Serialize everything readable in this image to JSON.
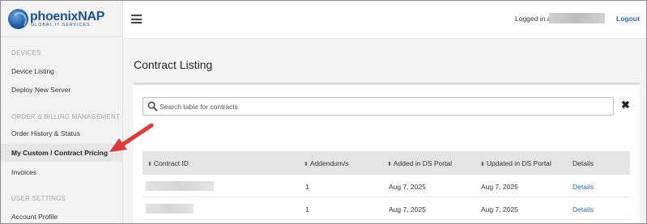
{
  "brand": {
    "name_part1": "phoenix",
    "name_part2": "NAP",
    "tagline": "GLOBAL IT SERVICES",
    "color": "#1d4f91"
  },
  "sidebar": {
    "sections": [
      {
        "heading": "DEVICES",
        "items": [
          "Device Listing",
          "Deploy New Server"
        ]
      },
      {
        "heading": "ORDER & BILLING MANAGEMENT",
        "items": [
          "Order History & Status",
          "My Custom / Contract Pricing",
          "Invoices"
        ]
      },
      {
        "heading": "USER SETTINGS",
        "items": [
          "Account Profile"
        ]
      }
    ],
    "active_item": "My Custom / Contract Pricing"
  },
  "header": {
    "menu_icon": "hamburger-icon",
    "logged_in_label": "Logged in as",
    "logout_label": "Logout"
  },
  "page": {
    "title": "Contract Listing"
  },
  "search": {
    "placeholder": "Search table for contracts",
    "value": "",
    "clear_icon": "close-icon",
    "clear_glyph": "✖"
  },
  "table": {
    "sort_glyph": "⬍",
    "columns": [
      "Contract ID",
      "Addendum/s",
      "Added in DS Portal",
      "Updated in DS Portal",
      "Details"
    ],
    "rows": [
      {
        "contract_id": "",
        "addendum": "1",
        "added": "Aug 7, 2025",
        "updated": "Aug 7, 2025",
        "details": "Details"
      },
      {
        "contract_id": "",
        "addendum": "1",
        "added": "Aug 7, 2025",
        "updated": "Aug 7, 2025",
        "details": "Details"
      }
    ]
  },
  "annotation": {
    "type": "arrow",
    "color": "#e0393a",
    "points_to": "My Custom / Contract Pricing"
  },
  "colors": {
    "link": "#2a6db5",
    "sidebar_bg": "#f3f3f3",
    "active_item_bg": "#e6e6e6"
  }
}
